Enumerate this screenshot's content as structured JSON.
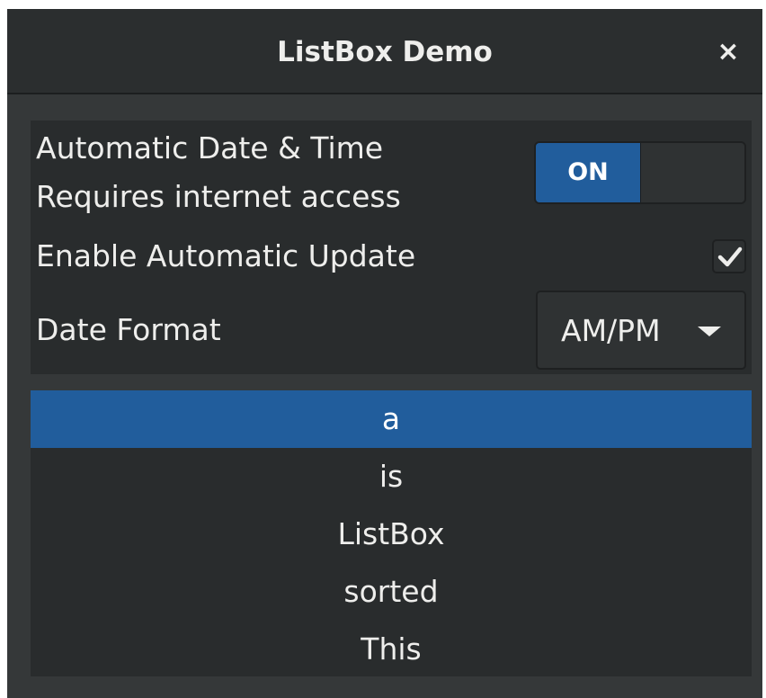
{
  "window": {
    "title": "ListBox Demo",
    "close_glyph": "×"
  },
  "settings": {
    "auto_datetime_label": "Automatic Date & Time",
    "auto_datetime_sub": "Requires internet access",
    "switch_state": "ON",
    "update_label": "Enable Automatic Update",
    "update_checked": true,
    "date_format_label": "Date Format",
    "date_format_value": "AM/PM"
  },
  "listbox": {
    "items": [
      {
        "text": "a",
        "selected": true
      },
      {
        "text": "is",
        "selected": false
      },
      {
        "text": "ListBox",
        "selected": false
      },
      {
        "text": "sorted",
        "selected": false
      },
      {
        "text": "This",
        "selected": false
      }
    ]
  },
  "colors": {
    "accent": "#215d9c",
    "window_bg": "#353839",
    "panel_bg": "#292c2d",
    "text": "#eeeeec"
  },
  "icons": {
    "close": "close-icon",
    "check": "check-icon",
    "dropdown": "chevron-down-icon"
  }
}
